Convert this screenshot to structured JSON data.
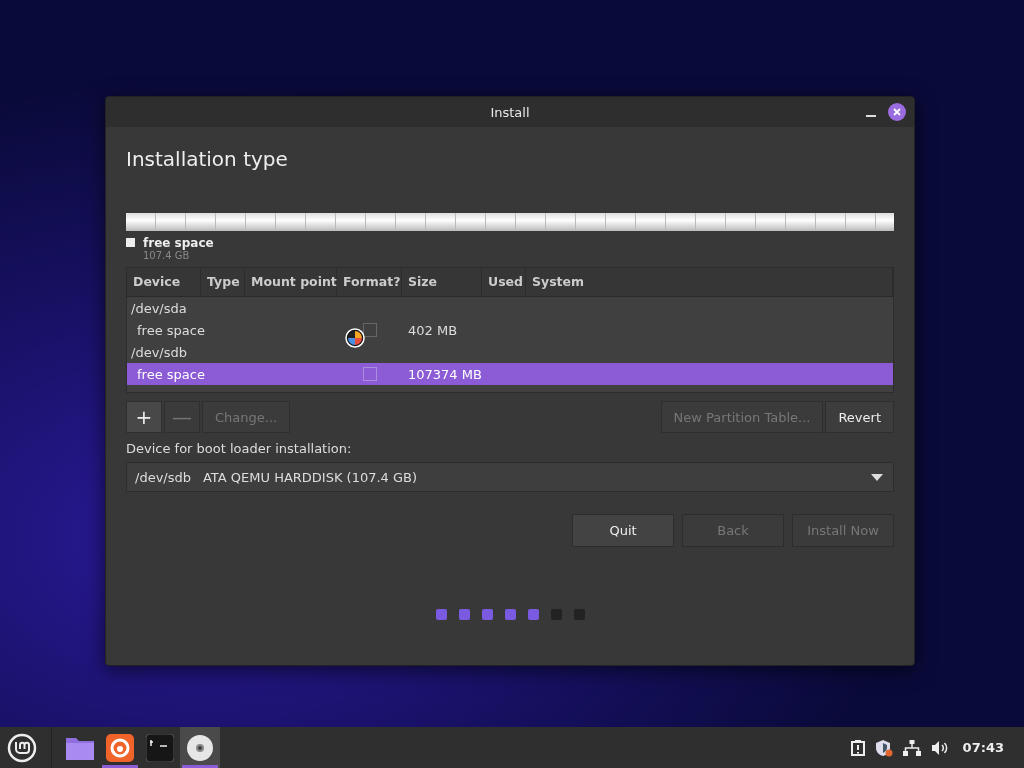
{
  "window": {
    "title": "Install"
  },
  "heading": "Installation type",
  "partition_bar": {
    "legend": [
      {
        "label": "free space",
        "size": "107.4 GB",
        "color": "#eeeeee"
      }
    ]
  },
  "table": {
    "columns": [
      "Device",
      "Type",
      "Mount point",
      "Format?",
      "Size",
      "Used",
      "System"
    ],
    "rows": [
      {
        "kind": "device",
        "device": "/dev/sda",
        "selected": false
      },
      {
        "kind": "partition",
        "device": "free space",
        "type": "",
        "mount": "",
        "format": false,
        "size": "402 MB",
        "used": "",
        "system": "",
        "selected": false
      },
      {
        "kind": "device",
        "device": "/dev/sdb",
        "selected": false
      },
      {
        "kind": "partition",
        "device": "free space",
        "type": "",
        "mount": "",
        "format": false,
        "size": "107374 MB",
        "used": "",
        "system": "",
        "selected": true
      }
    ]
  },
  "table_buttons": [
    {
      "label": "+",
      "kind": "icon",
      "disabled": false
    },
    {
      "label": "—",
      "kind": "icon",
      "disabled": true
    },
    {
      "label": "Change...",
      "kind": "text",
      "disabled": true
    }
  ],
  "table_buttons_right": [
    {
      "label": "New Partition Table...",
      "disabled": true
    },
    {
      "label": "Revert",
      "disabled": false
    }
  ],
  "boot_loader": {
    "label": "Device for boot loader installation:",
    "device": "/dev/sdb",
    "description": "ATA QEMU HARDDISK (107.4 GB)"
  },
  "actions": [
    {
      "label": "Quit",
      "disabled": false
    },
    {
      "label": "Back",
      "disabled": true
    },
    {
      "label": "Install Now",
      "disabled": true
    }
  ],
  "steps": [
    {
      "done": true
    },
    {
      "done": true
    },
    {
      "done": true
    },
    {
      "done": true
    },
    {
      "done": true
    },
    {
      "done": false
    },
    {
      "done": false
    }
  ],
  "taskbar": {
    "apps": [
      {
        "kind": "folder",
        "running": false,
        "selected": false
      },
      {
        "kind": "browser",
        "running": true,
        "selected": false
      },
      {
        "kind": "terminal",
        "running": false,
        "selected": false
      },
      {
        "kind": "disc",
        "running": true,
        "selected": true
      }
    ],
    "clock": "07:43"
  }
}
